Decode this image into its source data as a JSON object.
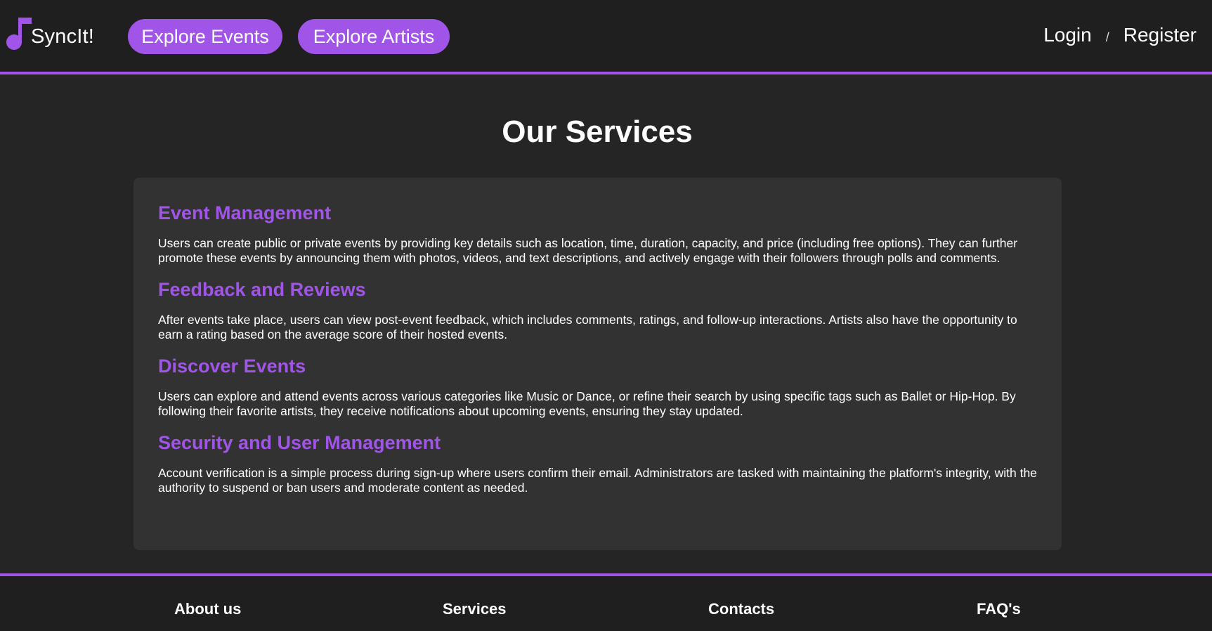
{
  "header": {
    "logo_text": "SyncIt!",
    "nav": {
      "explore_events": "Explore Events",
      "explore_artists": "Explore Artists"
    },
    "auth": {
      "login": "Login",
      "separator": "/",
      "register": "Register"
    }
  },
  "main": {
    "title": "Our Services",
    "services": [
      {
        "title": "Event Management",
        "text": "Users can create public or private events by providing key details such as location, time, duration, capacity, and price (including free options). They can further promote these events by announcing them with photos, videos, and text descriptions, and actively engage with their followers through polls and comments."
      },
      {
        "title": "Feedback and Reviews",
        "text": "After events take place, users can view post-event feedback, which includes comments, ratings, and follow-up interactions. Artists also have the opportunity to earn a rating based on the average score of their hosted events."
      },
      {
        "title": "Discover Events",
        "text": "Users can explore and attend events across various categories like Music or Dance, or refine their search by using specific tags such as Ballet or Hip-Hop. By following their favorite artists, they receive notifications about upcoming events, ensuring they stay updated."
      },
      {
        "title": "Security and User Management",
        "text": "Account verification is a simple process during sign-up where users confirm their email. Administrators are tasked with maintaining the platform's integrity, with the authority to suspend or ban users and moderate content as needed."
      }
    ]
  },
  "footer": {
    "about": "About us",
    "services": "Services",
    "contacts": "Contacts",
    "faq": "FAQ's"
  },
  "colors": {
    "accent": "#a155e8",
    "header_bg": "#1f1f1f",
    "page_bg": "#252525",
    "panel_bg": "#323232"
  },
  "icons": {
    "logo": "music-note-icon"
  }
}
